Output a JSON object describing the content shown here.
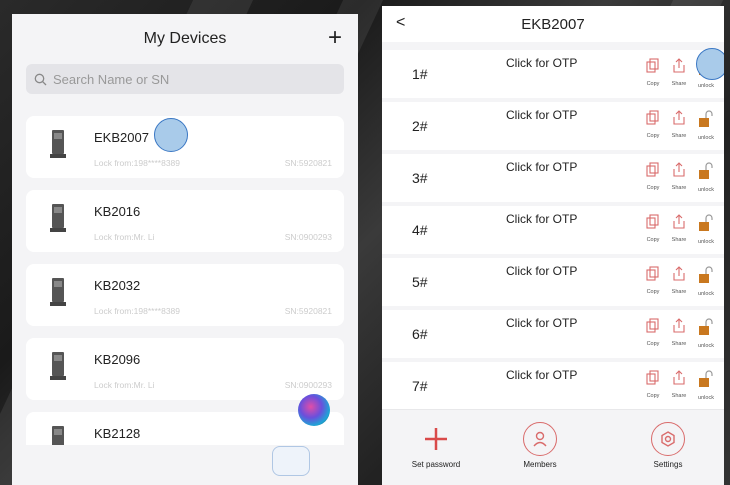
{
  "left": {
    "title": "My Devices",
    "add_label": "+",
    "search_placeholder": "Search Name or SN",
    "devices": [
      {
        "name": "EKB2007",
        "sub": "Lock from:198****8389",
        "sn": "SN:5920821"
      },
      {
        "name": "KB2016",
        "sub": "Lock from:Mr. Li",
        "sn": "SN:0900293"
      },
      {
        "name": "KB2032",
        "sub": "Lock from:198****8389",
        "sn": "SN:5920821"
      },
      {
        "name": "KB2096",
        "sub": "Lock from:Mr. Li",
        "sn": "SN:0900293"
      },
      {
        "name": "KB2128",
        "sub": "",
        "sn": ""
      }
    ]
  },
  "right": {
    "back_label": "<",
    "title": "EKB2007",
    "slots": [
      {
        "num": "1#",
        "otp": "Click for OTP"
      },
      {
        "num": "2#",
        "otp": "Click for OTP"
      },
      {
        "num": "3#",
        "otp": "Click for OTP"
      },
      {
        "num": "4#",
        "otp": "Click for OTP"
      },
      {
        "num": "5#",
        "otp": "Click for OTP"
      },
      {
        "num": "6#",
        "otp": "Click for OTP"
      },
      {
        "num": "7#",
        "otp": "Click for OTP"
      }
    ],
    "action_labels": {
      "copy": "Copy",
      "share": "Share",
      "unlock": "unlock"
    },
    "bottom": {
      "set_password": "Set password",
      "members": "Members",
      "settings": "Settings"
    }
  },
  "colors": {
    "accent_red": "#d94a4a",
    "unlock_orange": "#c9781f",
    "highlight_blue": "#a9cbea"
  }
}
